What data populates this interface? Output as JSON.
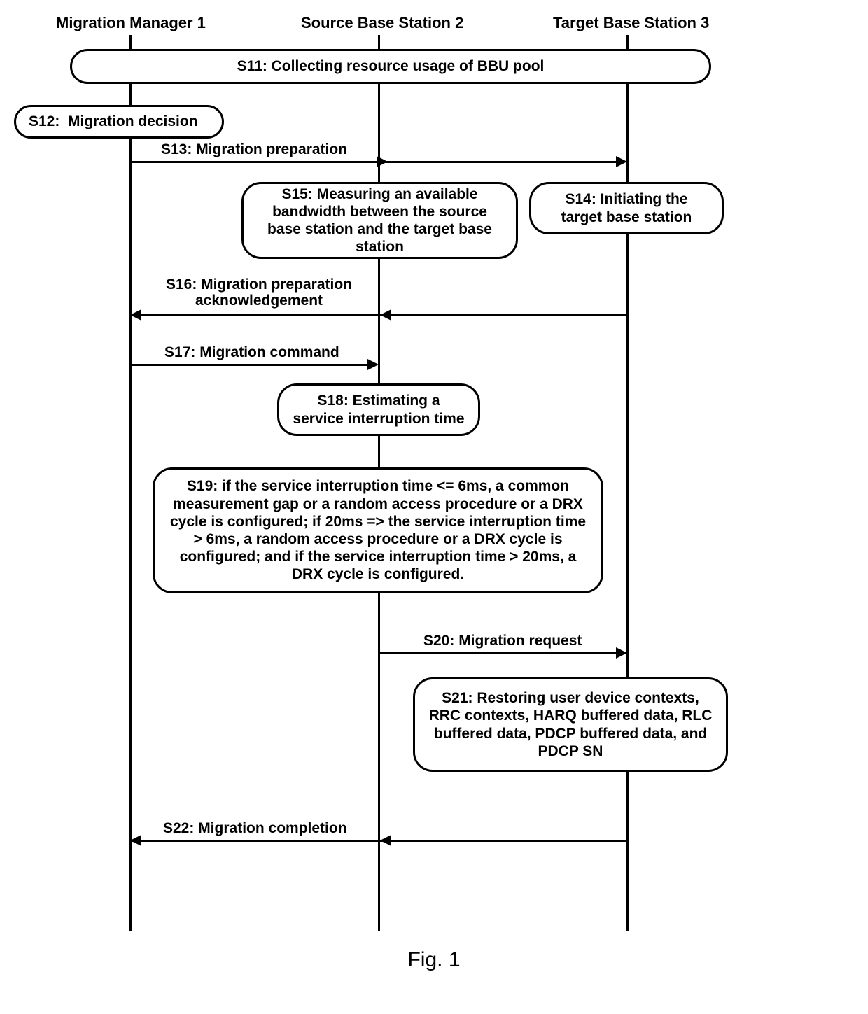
{
  "participants": {
    "p1": "Migration Manager 1",
    "p2": "Source Base Station 2",
    "p3": "Target Base Station 3"
  },
  "nodes": {
    "s11": "S11: Collecting resource usage of BBU pool",
    "s12": "S12:  Migration decision",
    "s14": "S14: Initiating the target base station",
    "s15": "S15: Measuring an available bandwidth between the source base station and the target base station",
    "s18": "S18: Estimating a service interruption time",
    "s19": "S19: if the service interruption time <= 6ms, a common measurement gap or a random access procedure or a DRX cycle is configured; if 20ms => the service interruption time > 6ms, a random access procedure or a DRX cycle is configured; and if the service interruption time > 20ms, a DRX cycle is configured.",
    "s21": "S21: Restoring user device contexts, RRC contexts, HARQ buffered data, RLC buffered data, PDCP buffered data, and PDCP SN"
  },
  "messages": {
    "s13": "S13: Migration preparation",
    "s16": "S16: Migration preparation acknowledgement",
    "s17": "S17: Migration command",
    "s20": "S20: Migration request",
    "s22": "S22: Migration completion"
  },
  "caption": "Fig. 1",
  "chart_data": {
    "type": "sequence-diagram",
    "participants": [
      "Migration Manager 1",
      "Source Base Station 2",
      "Target Base Station 3"
    ],
    "steps": [
      {
        "id": "S11",
        "from": "all",
        "to": "all",
        "kind": "activity",
        "text": "Collecting resource usage of BBU pool"
      },
      {
        "id": "S12",
        "from": "Migration Manager 1",
        "to": "Migration Manager 1",
        "kind": "activity",
        "text": "Migration decision"
      },
      {
        "id": "S13",
        "from": "Migration Manager 1",
        "to": "Target Base Station 3",
        "kind": "message",
        "text": "Migration preparation"
      },
      {
        "id": "S15",
        "from": "Source Base Station 2",
        "to": "Source Base Station 2",
        "kind": "activity",
        "text": "Measuring an available bandwidth between the source base station and the target base station"
      },
      {
        "id": "S14",
        "from": "Target Base Station 3",
        "to": "Target Base Station 3",
        "kind": "activity",
        "text": "Initiating the target base station"
      },
      {
        "id": "S16",
        "from": "Target Base Station 3",
        "to": "Migration Manager 1",
        "kind": "message",
        "text": "Migration preparation acknowledgement",
        "via": "Source Base Station 2"
      },
      {
        "id": "S17",
        "from": "Migration Manager 1",
        "to": "Source Base Station 2",
        "kind": "message",
        "text": "Migration command"
      },
      {
        "id": "S18",
        "from": "Source Base Station 2",
        "to": "Source Base Station 2",
        "kind": "activity",
        "text": "Estimating a service interruption time"
      },
      {
        "id": "S19",
        "from": "Source Base Station 2",
        "to": "Source Base Station 2",
        "kind": "activity",
        "text": "if the service interruption time <= 6ms, a common measurement gap or a random access procedure or a DRX cycle is configured; if 20ms => the service interruption time > 6ms, a random access procedure or a DRX cycle is configured; and if the service interruption time > 20ms, a DRX cycle is configured."
      },
      {
        "id": "S20",
        "from": "Source Base Station 2",
        "to": "Target Base Station 3",
        "kind": "message",
        "text": "Migration request"
      },
      {
        "id": "S21",
        "from": "Target Base Station 3",
        "to": "Target Base Station 3",
        "kind": "activity",
        "text": "Restoring user device contexts, RRC contexts, HARQ buffered data, RLC buffered data, PDCP buffered data, and PDCP SN"
      },
      {
        "id": "S22",
        "from": "Target Base Station 3",
        "to": "Migration Manager 1",
        "kind": "message",
        "text": "Migration completion",
        "via": "Source Base Station 2"
      }
    ]
  }
}
